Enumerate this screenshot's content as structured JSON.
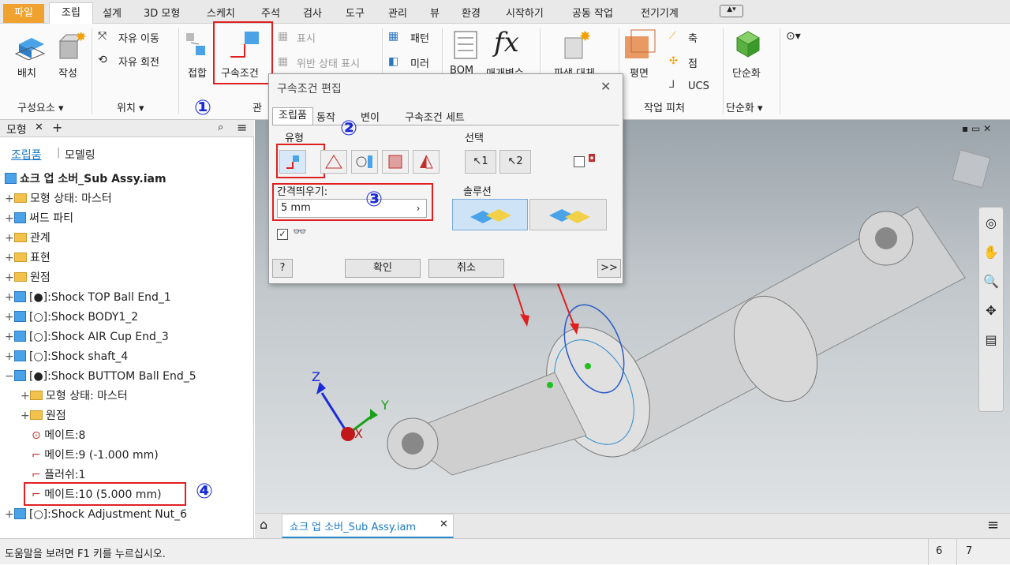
{
  "menubar": {
    "file": "파일",
    "tabs": [
      "조립",
      "설계",
      "3D 모형",
      "스케치",
      "주석",
      "검사",
      "도구",
      "관리",
      "뷰",
      "환경",
      "시작하기",
      "공동 작업",
      "전기기계"
    ]
  },
  "ribbon": {
    "place": "배치",
    "create": "작성",
    "free_move": "자유 이동",
    "free_rotate": "자유 회전",
    "join": "접합",
    "constrain": "구속조건",
    "show": "표시",
    "show_sick": "위반 상태 표시",
    "pattern": "패턴",
    "mirror": "미러",
    "bom": "BOM",
    "params": "매개변수",
    "replace": "파생 대체",
    "plane": "평면",
    "axis": "축",
    "point": "점",
    "ucs": "UCS",
    "simplify": "단순화",
    "panel_component": "구성요소 ▾",
    "panel_position": "위치 ▾",
    "panel_relation": "관",
    "panel_work": "작업 피처",
    "panel_simplify": "단순화 ▾"
  },
  "browser": {
    "title": "모형",
    "tab_assembly": "조립품",
    "tab_modeling": "모델링",
    "root": "쇼크 업 소버_Sub Assy.iam",
    "items": [
      {
        "label": "모형 상태: 마스터",
        "type": "folder"
      },
      {
        "label": "써드 파티",
        "type": "folder"
      },
      {
        "label": "관계",
        "type": "folder"
      },
      {
        "label": "표현",
        "type": "folder"
      },
      {
        "label": "원점",
        "type": "folder"
      },
      {
        "label": "[●]:Shock TOP Ball End_1",
        "type": "part"
      },
      {
        "label": "[○]:Shock BODY1_2",
        "type": "part"
      },
      {
        "label": "[○]:Shock AIR Cup End_3",
        "type": "part"
      },
      {
        "label": "[○]:Shock shaft_4",
        "type": "part"
      },
      {
        "label": "[●]:Shock BUTTOM Ball End_5",
        "type": "part"
      },
      {
        "label": "모형 상태: 마스터",
        "type": "folder"
      },
      {
        "label": "원점",
        "type": "folder"
      },
      {
        "label": "메이트:8",
        "type": "mate"
      },
      {
        "label": "메이트:9 (-1.000 mm)",
        "type": "mate"
      },
      {
        "label": "플러쉬:1",
        "type": "mate"
      },
      {
        "label": "메이트:10 (5.000 mm)",
        "type": "mate"
      },
      {
        "label": "[○]:Shock Adjustment Nut_6",
        "type": "part"
      }
    ]
  },
  "dialog": {
    "title": "구속조건 편집",
    "tabs": [
      "조립품",
      "동작",
      "변이",
      "구속조건 세트"
    ],
    "type_label": "유형",
    "select_label": "선택",
    "select1": "1",
    "select2": "2",
    "offset_label": "간격띄우기:",
    "offset_value": "5 mm",
    "solution_label": "솔루션",
    "ok": "확인",
    "cancel": "취소",
    "more": ">>",
    "help": "?"
  },
  "annotations": {
    "n1": "①",
    "n2": "②",
    "n3": "③",
    "n4": "④"
  },
  "doctab": {
    "label": "쇼크 업 소버_Sub Assy.iam"
  },
  "status": {
    "help": "도움말을 보려면 F1 키를 누르십시오.",
    "c1": "6",
    "c2": "7"
  },
  "axes": {
    "x": "X",
    "y": "Y",
    "z": "Z"
  }
}
